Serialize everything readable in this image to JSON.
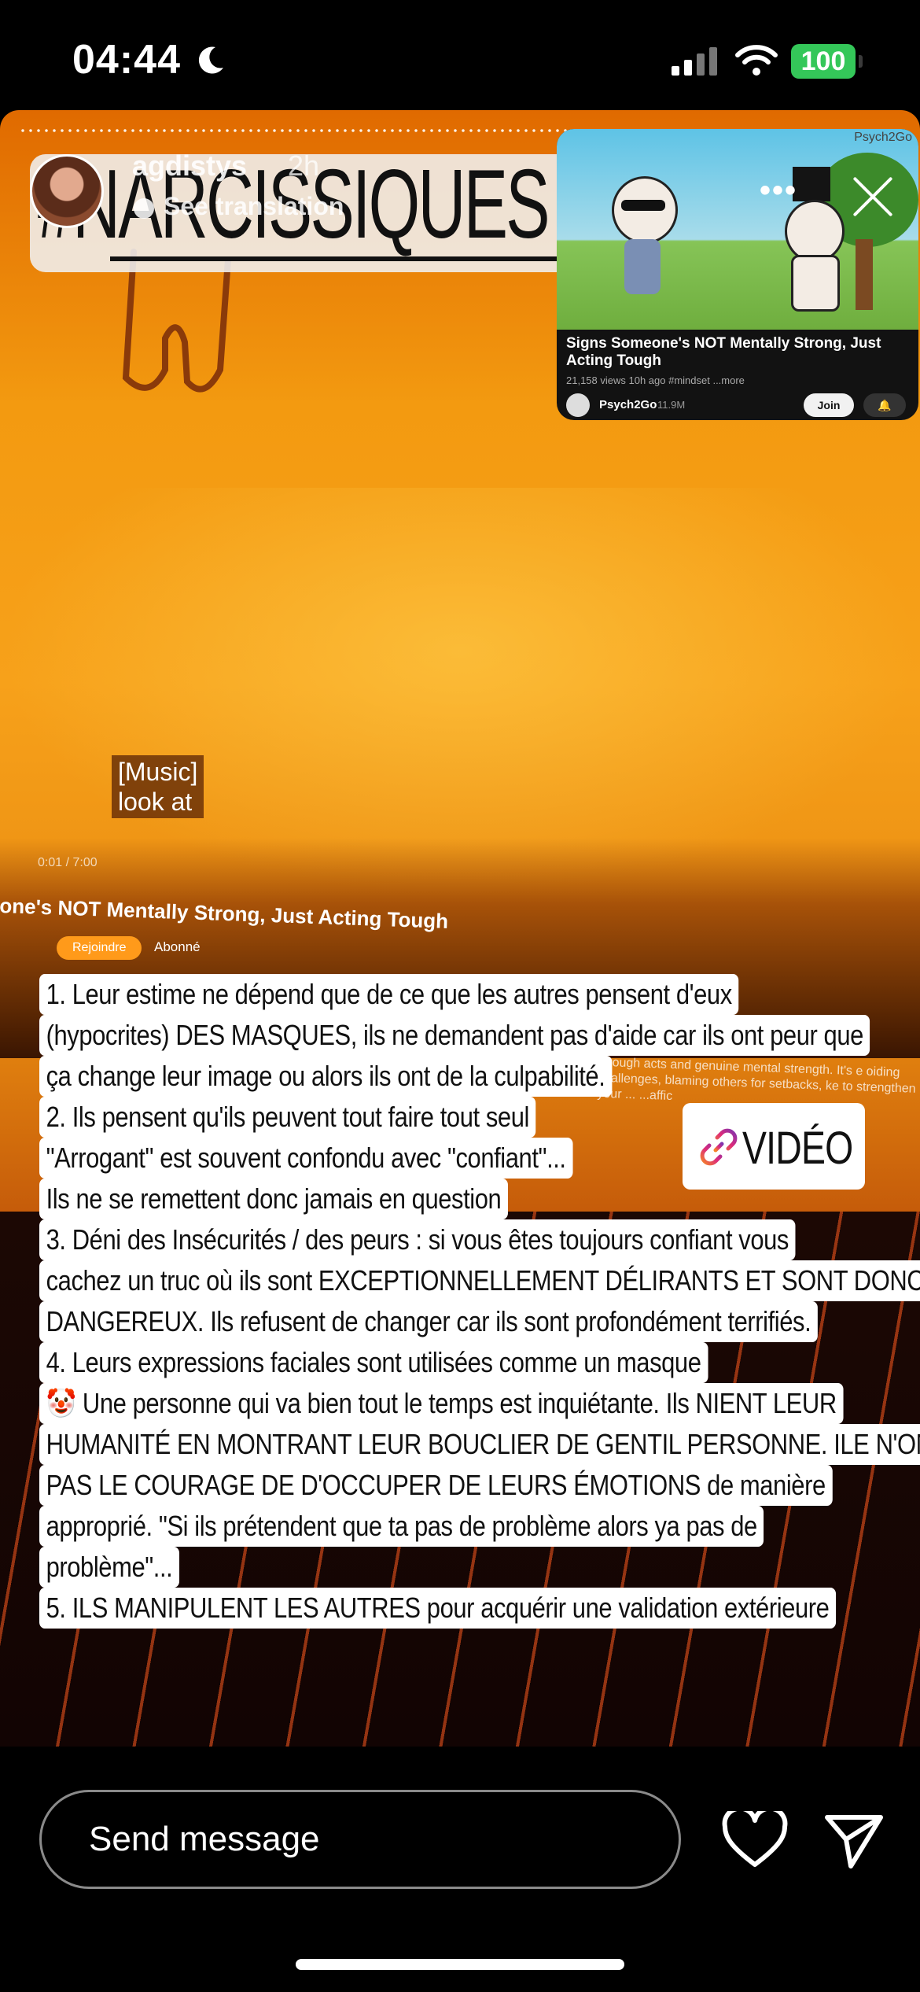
{
  "status_bar": {
    "time": "04:44",
    "battery": "100"
  },
  "story": {
    "username": "agdistys",
    "time_ago": "2h",
    "see_translation": "See translation",
    "hashtag": "#NARCISSIQUES",
    "music_caption": [
      "[Music]",
      "look at"
    ],
    "player_time": "0:01 / 7:00",
    "background_video_title": "one's NOT Mentally Strong, Just Acting Tough",
    "background_subscribe": "Rejoindre",
    "background_abonne": "Abonné",
    "background_desc": "n tough acts and genuine mental strength. It's e  oiding challenges, blaming others for setbacks,  ke to strengthen your ...  ...affic",
    "sticker_label": "VIDÉO",
    "lines": [
      "1.  Leur estime ne dépend que de ce que les autres pensent d'eux",
      "(hypocrites) DES MASQUES, ils ne demandent pas d'aide car ils ont peur que",
      "ça change leur image  ou alors ils ont de la culpabilité.",
      "2.  Ils pensent qu'ils peuvent tout faire tout seul",
      "\"Arrogant\" est souvent confondu avec \"confiant\"...",
      "Ils ne se remettent donc jamais en question",
      "3.  Déni des Insécurités / des peurs : si vous êtes toujours confiant vous",
      "cachez un truc où ils sont EXCEPTIONNELLEMENT DÉLIRANTS ET SONT DONC",
      "DANGEREUX. Ils refusent de changer car ils sont profondément terrifiés.",
      "4. Leurs expressions faciales sont utilisées comme un masque",
      "🤡 Une personne qui va bien tout le temps est inquiétante. Ils NIENT LEUR",
      "HUMANITÉ EN MONTRANT LEUR BOUCLIER DE GENTIL PERSONNE. ILE N'ONT",
      "PAS LE COURAGE DE D'OCCUPER DE LEURS ÉMOTIONS de manière",
      "approprié. \"Si ils prétendent que ta pas de problème alors ya pas de",
      "problème\"...",
      "5. ILS MANIPULENT LES AUTRES pour acquérir une validation extérieure"
    ]
  },
  "video_card": {
    "brand": "Psych2Go",
    "title": "Signs Someone's NOT Mentally Strong, Just Acting Tough",
    "meta": "21,158 views  10h ago  #mindset  ...more",
    "channel": "Psych2Go",
    "subscribers": "11.9M",
    "join_label": "Join"
  },
  "bottom_bar": {
    "message_placeholder": "Send message"
  },
  "colors": {
    "battery": "#34c759",
    "story_orange": "#f39a10"
  }
}
